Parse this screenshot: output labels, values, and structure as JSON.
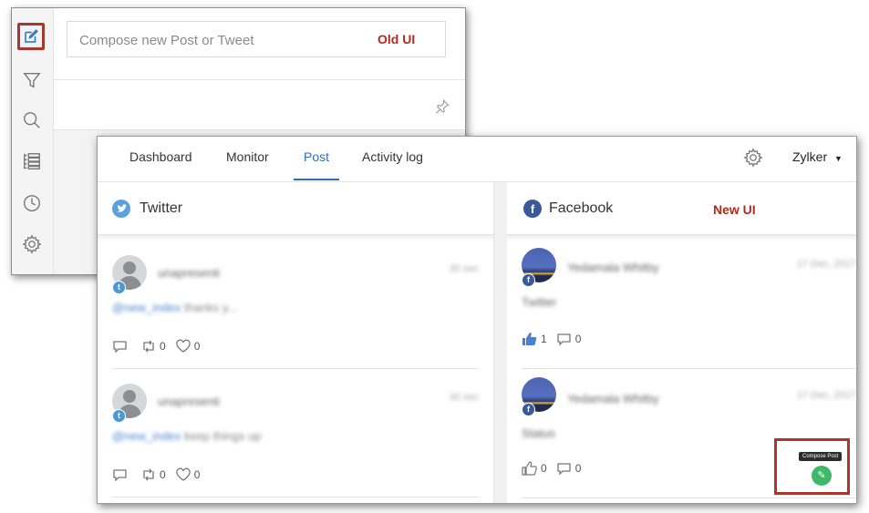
{
  "old_ui": {
    "compose_placeholder": "Compose new Post or Tweet",
    "label": "Old UI",
    "sidebar_icons": [
      "compose-icon",
      "filter-icon",
      "search-icon",
      "list-icon",
      "clock-icon",
      "gear-icon"
    ]
  },
  "new_ui": {
    "label": "New UI",
    "tabs": [
      {
        "label": "Dashboard"
      },
      {
        "label": "Monitor"
      },
      {
        "label": "Post",
        "active": true
      },
      {
        "label": "Activity log"
      }
    ],
    "org": "Zylker",
    "columns": [
      {
        "network": "Twitter",
        "posts": [
          {
            "replies": "",
            "retweets": "0",
            "likes": "0"
          },
          {
            "replies": "",
            "retweets": "0",
            "likes": "0"
          }
        ]
      },
      {
        "network": "Facebook",
        "posts": [
          {
            "likes": "1",
            "comments": "0"
          },
          {
            "likes": "0",
            "comments": "0"
          }
        ]
      }
    ],
    "compose_tooltip": "Compose Post"
  },
  "colors": {
    "accent": "#2f6db5",
    "highlight": "#a9372b",
    "label_red": "#b22a1c",
    "fab_green": "#3fb86a"
  }
}
